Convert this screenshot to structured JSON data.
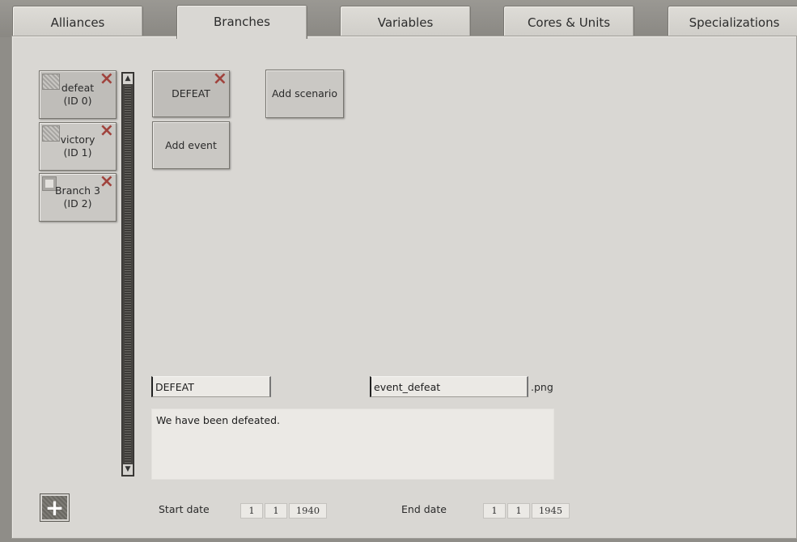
{
  "tabs": [
    {
      "label": "Alliances"
    },
    {
      "label": "Branches"
    },
    {
      "label": "Variables"
    },
    {
      "label": "Cores & Units"
    },
    {
      "label": "Specializations"
    }
  ],
  "branches": [
    {
      "name": "defeat",
      "id": "(ID 0)"
    },
    {
      "name": "victory",
      "id": "(ID 1)"
    },
    {
      "name": "Branch 3",
      "id": "(ID 2)"
    }
  ],
  "events": {
    "selected_label": "DEFEAT",
    "add_event_label": "Add event",
    "add_scenario_label": "Add scenario"
  },
  "editor": {
    "event_name": "DEFEAT",
    "image_name": "event_defeat",
    "image_ext": ".png",
    "description": "We have been defeated."
  },
  "dates": {
    "start_label": "Start date",
    "start_day": "1",
    "start_month": "1",
    "start_year": "1940",
    "end_label": "End date",
    "end_day": "1",
    "end_month": "1",
    "end_year": "1945"
  },
  "icons": {
    "delete": "×",
    "scroll_up": "▲",
    "scroll_down": "▼",
    "add": "+"
  }
}
